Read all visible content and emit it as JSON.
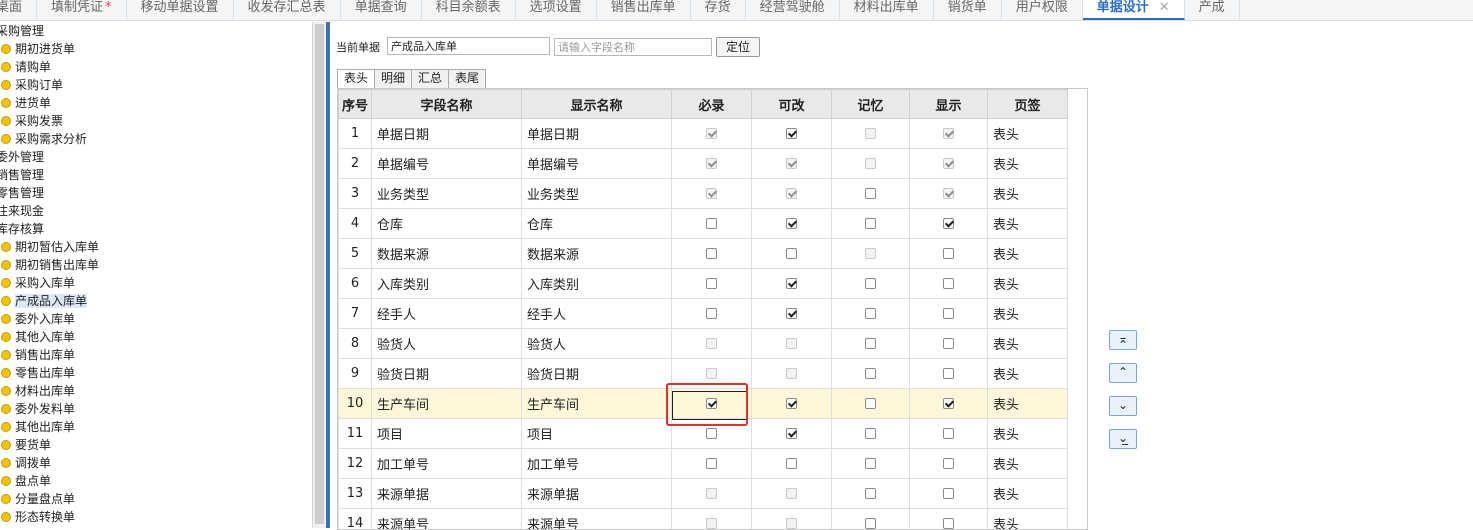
{
  "tabs": [
    {
      "label": "桌面"
    },
    {
      "label": "填制凭证",
      "modified": "*"
    },
    {
      "label": "移动单据设置"
    },
    {
      "label": "收发存汇总表"
    },
    {
      "label": "单据查询"
    },
    {
      "label": "科目余额表"
    },
    {
      "label": "选项设置"
    },
    {
      "label": "销售出库单"
    },
    {
      "label": "存货"
    },
    {
      "label": "经营驾驶舱"
    },
    {
      "label": "材料出库单"
    },
    {
      "label": "销货单"
    },
    {
      "label": "用户权限"
    },
    {
      "label": "单据设计",
      "active": true,
      "close": "✕"
    },
    {
      "label": "产成"
    }
  ],
  "tree": [
    {
      "label": "采购管理",
      "type": "group"
    },
    {
      "label": "期初进货单",
      "type": "leaf"
    },
    {
      "label": "请购单",
      "type": "leaf"
    },
    {
      "label": "采购订单",
      "type": "leaf"
    },
    {
      "label": "进货单",
      "type": "leaf"
    },
    {
      "label": "采购发票",
      "type": "leaf"
    },
    {
      "label": "采购需求分析",
      "type": "leaf"
    },
    {
      "label": "委外管理",
      "type": "group"
    },
    {
      "label": "销售管理",
      "type": "group"
    },
    {
      "label": "零售管理",
      "type": "group"
    },
    {
      "label": "往来现金",
      "type": "group"
    },
    {
      "label": "库存核算",
      "type": "group"
    },
    {
      "label": "期初暂估入库单",
      "type": "leaf"
    },
    {
      "label": "期初销售出库单",
      "type": "leaf"
    },
    {
      "label": "采购入库单",
      "type": "leaf"
    },
    {
      "label": "产成品入库单",
      "type": "leaf",
      "selected": true
    },
    {
      "label": "委外入库单",
      "type": "leaf"
    },
    {
      "label": "其他入库单",
      "type": "leaf"
    },
    {
      "label": "销售出库单",
      "type": "leaf"
    },
    {
      "label": "零售出库单",
      "type": "leaf"
    },
    {
      "label": "材料出库单",
      "type": "leaf"
    },
    {
      "label": "委外发料单",
      "type": "leaf"
    },
    {
      "label": "其他出库单",
      "type": "leaf"
    },
    {
      "label": "要货单",
      "type": "leaf"
    },
    {
      "label": "调拨单",
      "type": "leaf"
    },
    {
      "label": "盘点单",
      "type": "leaf"
    },
    {
      "label": "分量盘点单",
      "type": "leaf"
    },
    {
      "label": "形态转换单",
      "type": "leaf"
    }
  ],
  "form": {
    "current_label": "当前单据",
    "current_value": "产成品入库单",
    "search_placeholder": "请输入字段名称",
    "locate_button": "定位"
  },
  "subtabs": [
    {
      "label": "表头",
      "active": true
    },
    {
      "label": "明细"
    },
    {
      "label": "汇总"
    },
    {
      "label": "表尾"
    }
  ],
  "grid": {
    "headers": [
      "序号",
      "字段名称",
      "显示名称",
      "必录",
      "可改",
      "记忆",
      "显示",
      "页签"
    ],
    "rows": [
      {
        "seq": "1",
        "field": "单据日期",
        "display": "单据日期",
        "required": [
          true,
          true
        ],
        "editable": [
          true,
          false
        ],
        "memory": [
          false,
          true
        ],
        "show": [
          true,
          true
        ],
        "page": "表头"
      },
      {
        "seq": "2",
        "field": "单据编号",
        "display": "单据编号",
        "required": [
          true,
          true
        ],
        "editable": [
          true,
          true
        ],
        "memory": [
          false,
          true
        ],
        "show": [
          true,
          true
        ],
        "page": "表头"
      },
      {
        "seq": "3",
        "field": "业务类型",
        "display": "业务类型",
        "required": [
          true,
          true
        ],
        "editable": [
          true,
          true
        ],
        "memory": [
          false,
          false
        ],
        "show": [
          true,
          true
        ],
        "page": "表头"
      },
      {
        "seq": "4",
        "field": "仓库",
        "display": "仓库",
        "required": [
          false,
          false
        ],
        "editable": [
          true,
          false
        ],
        "memory": [
          false,
          false
        ],
        "show": [
          true,
          false
        ],
        "page": "表头"
      },
      {
        "seq": "5",
        "field": "数据来源",
        "display": "数据来源",
        "required": [
          false,
          false
        ],
        "editable": [
          false,
          false
        ],
        "memory": [
          false,
          true
        ],
        "show": [
          false,
          false
        ],
        "page": "表头"
      },
      {
        "seq": "6",
        "field": "入库类别",
        "display": "入库类别",
        "required": [
          false,
          false
        ],
        "editable": [
          true,
          false
        ],
        "memory": [
          false,
          false
        ],
        "show": [
          false,
          false
        ],
        "page": "表头"
      },
      {
        "seq": "7",
        "field": "经手人",
        "display": "经手人",
        "required": [
          false,
          false
        ],
        "editable": [
          true,
          false
        ],
        "memory": [
          false,
          false
        ],
        "show": [
          false,
          false
        ],
        "page": "表头"
      },
      {
        "seq": "8",
        "field": "验货人",
        "display": "验货人",
        "required": [
          false,
          true
        ],
        "editable": [
          false,
          true
        ],
        "memory": [
          false,
          false
        ],
        "show": [
          false,
          false
        ],
        "page": "表头"
      },
      {
        "seq": "9",
        "field": "验货日期",
        "display": "验货日期",
        "required": [
          false,
          true
        ],
        "editable": [
          false,
          true
        ],
        "memory": [
          false,
          false
        ],
        "show": [
          false,
          false
        ],
        "page": "表头"
      },
      {
        "seq": "10",
        "field": "生产车间",
        "display": "生产车间",
        "required": [
          true,
          false
        ],
        "editable": [
          true,
          false
        ],
        "memory": [
          false,
          false
        ],
        "show": [
          true,
          false
        ],
        "page": "表头",
        "highlight": true
      },
      {
        "seq": "11",
        "field": "项目",
        "display": "项目",
        "required": [
          false,
          false
        ],
        "editable": [
          true,
          false
        ],
        "memory": [
          false,
          false
        ],
        "show": [
          false,
          false
        ],
        "page": "表头"
      },
      {
        "seq": "12",
        "field": "加工单号",
        "display": "加工单号",
        "required": [
          false,
          false
        ],
        "editable": [
          false,
          false
        ],
        "memory": [
          false,
          false
        ],
        "show": [
          false,
          false
        ],
        "page": "表头"
      },
      {
        "seq": "13",
        "field": "来源单据",
        "display": "来源单据",
        "required": [
          false,
          true
        ],
        "editable": [
          false,
          true
        ],
        "memory": [
          false,
          false
        ],
        "show": [
          false,
          false
        ],
        "page": "表头"
      },
      {
        "seq": "14",
        "field": "来源单号",
        "display": "来源单号",
        "required": [
          false,
          true
        ],
        "editable": [
          false,
          true
        ],
        "memory": [
          false,
          false
        ],
        "show": [
          false,
          false
        ],
        "page": "表头"
      }
    ]
  },
  "move_buttons": [
    {
      "name": "move-top-button",
      "glyph": "⌅"
    },
    {
      "name": "move-up-button",
      "glyph": "⌃"
    },
    {
      "name": "move-down-button",
      "glyph": "⌄"
    },
    {
      "name": "move-bottom-button",
      "glyph": "⌄̲"
    }
  ]
}
